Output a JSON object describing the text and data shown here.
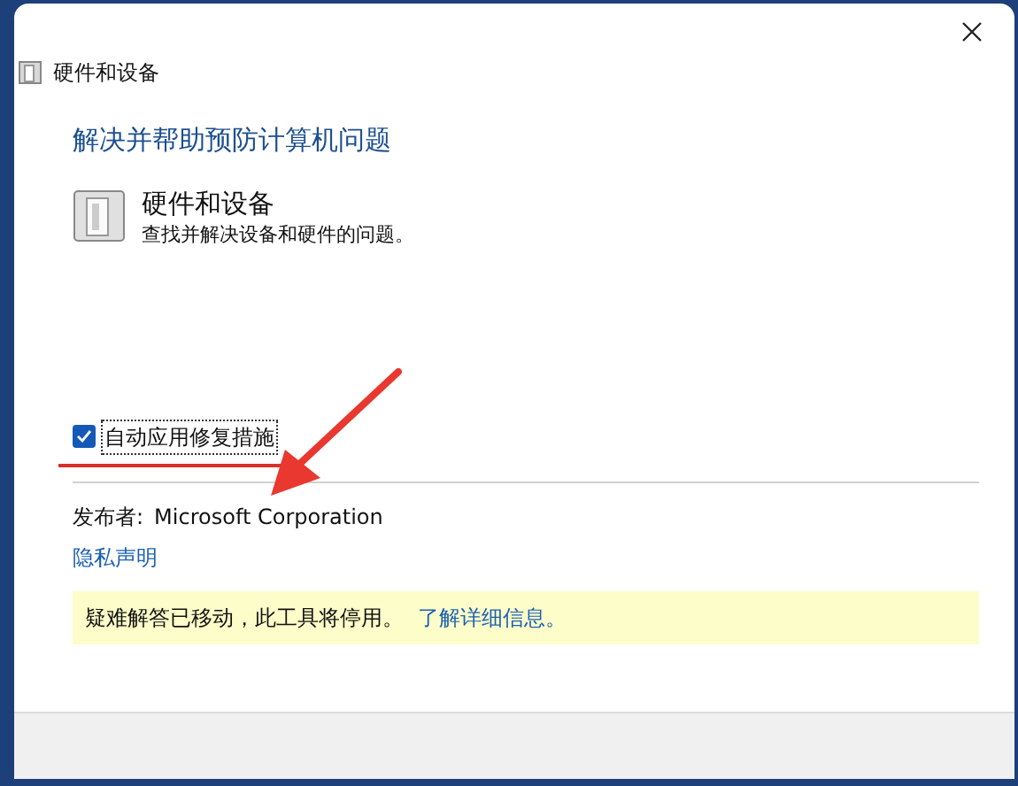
{
  "window": {
    "title": "硬件和设备"
  },
  "heading": "解决并帮助预防计算机问题",
  "troubleshooter": {
    "title": "硬件和设备",
    "description": "查找并解决设备和硬件的问题。"
  },
  "auto_repair": {
    "label": "自动应用修复措施",
    "checked": true
  },
  "publisher": {
    "label": "发布者:",
    "value": "Microsoft Corporation"
  },
  "privacy_link": "隐私声明",
  "notice": {
    "text": "疑难解答已移动，此工具将停用。",
    "link": "了解详细信息。"
  }
}
